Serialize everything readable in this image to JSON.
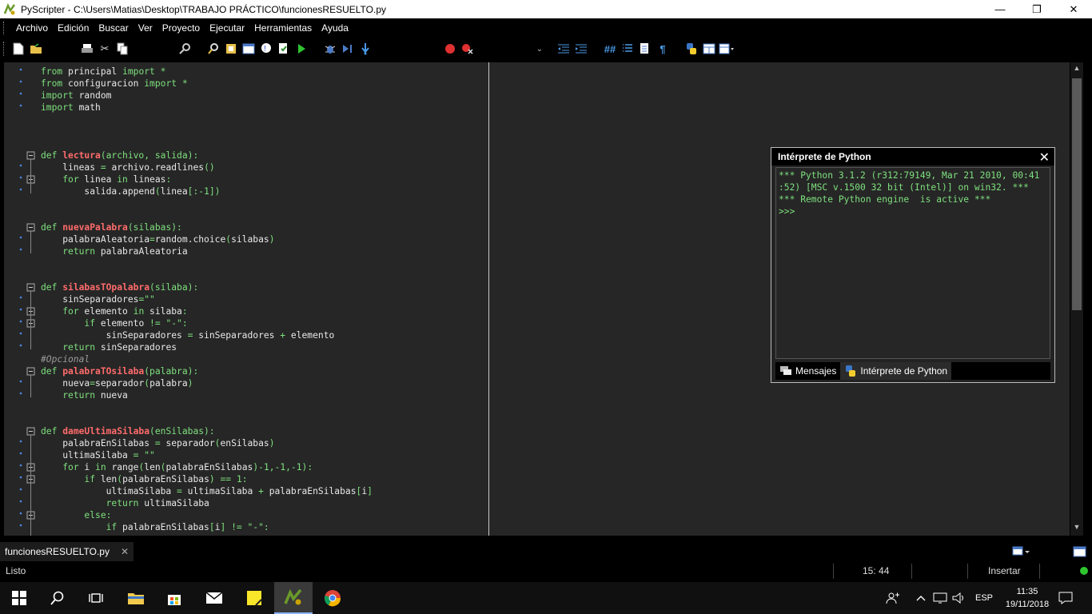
{
  "window": {
    "title": "PyScripter - C:\\Users\\Matias\\Desktop\\TRABAJO PRÁCTICO\\funcionesRESUELTO.py",
    "minimize": "—",
    "restore": "❐",
    "close": "✕"
  },
  "menu": [
    "Archivo",
    "Edición",
    "Buscar",
    "Ver",
    "Proyecto",
    "Ejecutar",
    "Herramientas",
    "Ayuda"
  ],
  "editor": {
    "lines": [
      [
        {
          "t": "from",
          "c": "kw"
        },
        {
          "t": " principal "
        },
        {
          "t": "import",
          "c": "kw"
        },
        {
          "t": " *",
          "c": "kw"
        }
      ],
      [
        {
          "t": "from",
          "c": "kw"
        },
        {
          "t": " configuracion "
        },
        {
          "t": "import",
          "c": "kw"
        },
        {
          "t": " *",
          "c": "kw"
        }
      ],
      [
        {
          "t": "import",
          "c": "kw"
        },
        {
          "t": " random"
        }
      ],
      [
        {
          "t": "import",
          "c": "kw"
        },
        {
          "t": " math"
        }
      ],
      [],
      [],
      [],
      [
        {
          "t": "def",
          "c": "kw"
        },
        {
          "t": " "
        },
        {
          "t": "lectura",
          "c": "fn"
        },
        {
          "t": "(archivo, salida):",
          "c": "kw"
        }
      ],
      [
        {
          "t": "    lineas "
        },
        {
          "t": "=",
          "c": "kw"
        },
        {
          "t": " archivo.readlines"
        },
        {
          "t": "()",
          "c": "kw"
        }
      ],
      [
        {
          "t": "    "
        },
        {
          "t": "for",
          "c": "kw"
        },
        {
          "t": " linea "
        },
        {
          "t": "in",
          "c": "kw"
        },
        {
          "t": " lineas"
        },
        {
          "t": ":",
          "c": "kw"
        }
      ],
      [
        {
          "t": "        salida.append"
        },
        {
          "t": "(",
          "c": "kw"
        },
        {
          "t": "linea"
        },
        {
          "t": "[:-1])",
          "c": "kw"
        }
      ],
      [],
      [],
      [
        {
          "t": "def",
          "c": "kw"
        },
        {
          "t": " "
        },
        {
          "t": "nuevaPalabra",
          "c": "fn"
        },
        {
          "t": "(silabas):",
          "c": "kw"
        }
      ],
      [
        {
          "t": "    palabraAleatoria"
        },
        {
          "t": "=",
          "c": "kw"
        },
        {
          "t": "random.choice"
        },
        {
          "t": "(",
          "c": "kw"
        },
        {
          "t": "silabas"
        },
        {
          "t": ")",
          "c": "kw"
        }
      ],
      [
        {
          "t": "    "
        },
        {
          "t": "return",
          "c": "kw"
        },
        {
          "t": " palabraAleatoria"
        }
      ],
      [],
      [],
      [
        {
          "t": "def",
          "c": "kw"
        },
        {
          "t": " "
        },
        {
          "t": "silabasTOpalabra",
          "c": "fn"
        },
        {
          "t": "(silaba):",
          "c": "kw"
        }
      ],
      [
        {
          "t": "    sinSeparadores"
        },
        {
          "t": "=\"\"",
          "c": "kw"
        }
      ],
      [
        {
          "t": "    "
        },
        {
          "t": "for",
          "c": "kw"
        },
        {
          "t": " elemento "
        },
        {
          "t": "in",
          "c": "kw"
        },
        {
          "t": " silaba"
        },
        {
          "t": ":",
          "c": "kw"
        }
      ],
      [
        {
          "t": "        "
        },
        {
          "t": "if",
          "c": "kw"
        },
        {
          "t": " elemento "
        },
        {
          "t": "!= \"-\":",
          "c": "kw"
        }
      ],
      [
        {
          "t": "            sinSeparadores "
        },
        {
          "t": "=",
          "c": "kw"
        },
        {
          "t": " sinSeparadores "
        },
        {
          "t": "+",
          "c": "kw"
        },
        {
          "t": " elemento"
        }
      ],
      [
        {
          "t": "    "
        },
        {
          "t": "return",
          "c": "kw"
        },
        {
          "t": " sinSeparadores"
        }
      ],
      [
        {
          "t": "#Opcional",
          "c": "cm"
        }
      ],
      [
        {
          "t": "def",
          "c": "kw"
        },
        {
          "t": " "
        },
        {
          "t": "palabraTOsilaba",
          "c": "fn"
        },
        {
          "t": "(palabra):",
          "c": "kw"
        }
      ],
      [
        {
          "t": "    nueva"
        },
        {
          "t": "=",
          "c": "kw"
        },
        {
          "t": "separador"
        },
        {
          "t": "(",
          "c": "kw"
        },
        {
          "t": "palabra"
        },
        {
          "t": ")",
          "c": "kw"
        }
      ],
      [
        {
          "t": "    "
        },
        {
          "t": "return",
          "c": "kw"
        },
        {
          "t": " nueva"
        }
      ],
      [],
      [],
      [
        {
          "t": "def",
          "c": "kw"
        },
        {
          "t": " "
        },
        {
          "t": "dameUltimaSilaba",
          "c": "fn"
        },
        {
          "t": "(enSilabas):",
          "c": "kw"
        }
      ],
      [
        {
          "t": "    palabraEnSilabas "
        },
        {
          "t": "=",
          "c": "kw"
        },
        {
          "t": " separador"
        },
        {
          "t": "(",
          "c": "kw"
        },
        {
          "t": "enSilabas"
        },
        {
          "t": ")",
          "c": "kw"
        }
      ],
      [
        {
          "t": "    ultimaSilaba "
        },
        {
          "t": "= \"\"",
          "c": "kw"
        }
      ],
      [
        {
          "t": "    "
        },
        {
          "t": "for",
          "c": "kw"
        },
        {
          "t": " i "
        },
        {
          "t": "in",
          "c": "kw"
        },
        {
          "t": " range"
        },
        {
          "t": "(",
          "c": "kw"
        },
        {
          "t": "len"
        },
        {
          "t": "(",
          "c": "kw"
        },
        {
          "t": "palabraEnSilabas"
        },
        {
          "t": ")-1,-1,-1):",
          "c": "kw"
        }
      ],
      [
        {
          "t": "        "
        },
        {
          "t": "if",
          "c": "kw"
        },
        {
          "t": " len"
        },
        {
          "t": "(",
          "c": "kw"
        },
        {
          "t": "palabraEnSilabas"
        },
        {
          "t": ") == 1:",
          "c": "kw"
        }
      ],
      [
        {
          "t": "            ultimaSilaba "
        },
        {
          "t": "=",
          "c": "kw"
        },
        {
          "t": " ultimaSilaba "
        },
        {
          "t": "+",
          "c": "kw"
        },
        {
          "t": " palabraEnSilabas"
        },
        {
          "t": "[",
          "c": "kw"
        },
        {
          "t": "i"
        },
        {
          "t": "]",
          "c": "kw"
        }
      ],
      [
        {
          "t": "            "
        },
        {
          "t": "return",
          "c": "kw"
        },
        {
          "t": " ultimaSilaba"
        }
      ],
      [
        {
          "t": "        "
        },
        {
          "t": "else:",
          "c": "kw"
        }
      ],
      [
        {
          "t": "            "
        },
        {
          "t": "if",
          "c": "kw"
        },
        {
          "t": " palabraEnSilabas"
        },
        {
          "t": "[",
          "c": "kw"
        },
        {
          "t": "i"
        },
        {
          "t": "] != \"-\":",
          "c": "kw"
        }
      ]
    ]
  },
  "interpreter": {
    "title": "Intérprete de Python",
    "close": "✕",
    "console": "*** Python 3.1.2 (r312:79149, Mar 21 2010, 00:41\n:52) [MSC v.1500 32 bit (Intel)] on win32. ***\n*** Remote Python engine  is active ***\n>>>",
    "tab_messages": "Mensajes",
    "tab_interpreter": "Intérprete de Python"
  },
  "editor_tab": {
    "label": "funcionesRESUELTO.py",
    "close": "✕"
  },
  "status": {
    "left": "Listo",
    "position": "15: 44",
    "mode": "Insertar"
  },
  "taskbar": {
    "lang": "ESP",
    "time": "11:35",
    "date": "19/11/2018"
  },
  "colors": {
    "keyword": "#7ee07e",
    "function": "#ff6b6b",
    "comment": "#9a9a9a"
  }
}
